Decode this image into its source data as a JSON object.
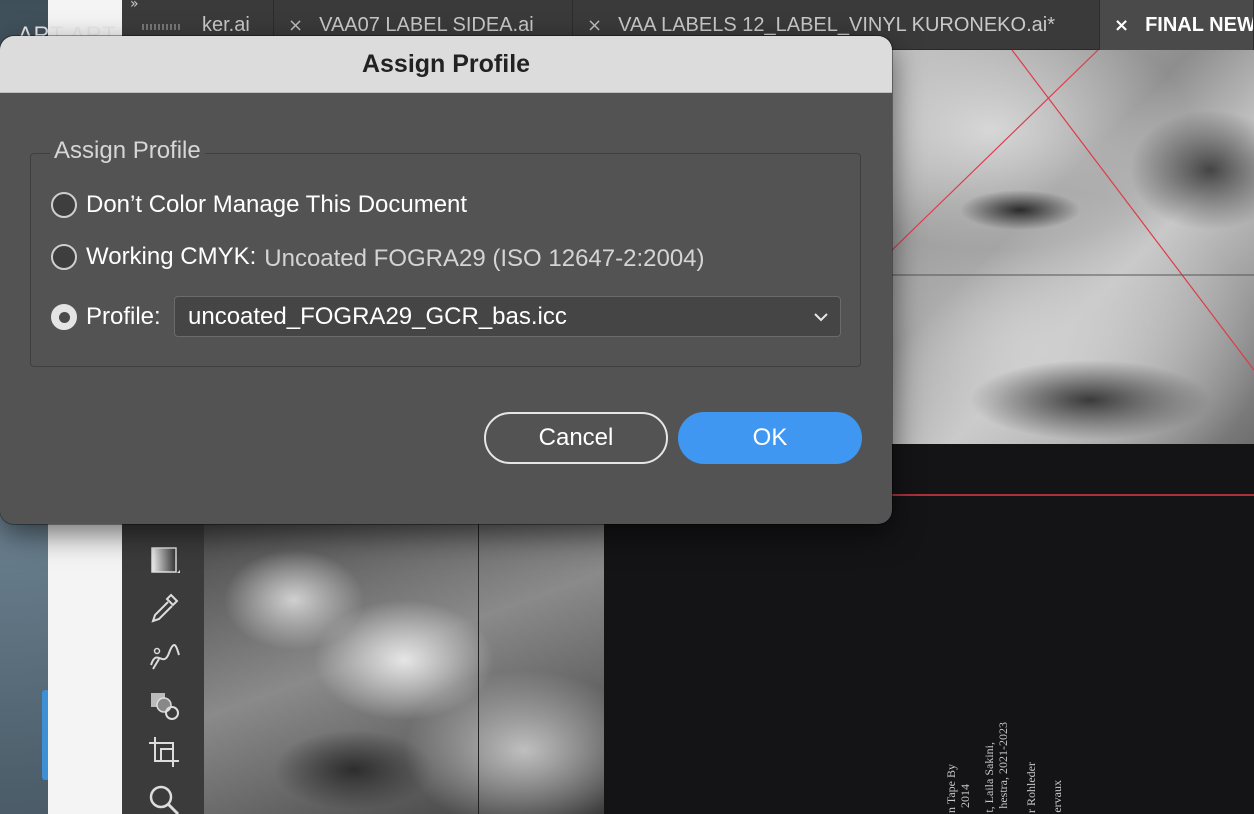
{
  "app": {
    "left_title_fragment": "ART ART"
  },
  "tabs": [
    {
      "label": "ker.ai",
      "close": "",
      "active": false
    },
    {
      "label": "VAA07 LABEL SIDEA.ai",
      "close": "×",
      "active": false
    },
    {
      "label": "VAA LABELS 12_LABEL_VINYL KURONEKO.ai*",
      "close": "×",
      "active": false
    },
    {
      "label": "FINAL NEW",
      "close": "×",
      "active": true
    }
  ],
  "toolbar": {
    "collapse_glyph": "»",
    "tools": [
      "gradient-tool-icon",
      "eyedropper-tool-icon",
      "puppet-warp-tool-icon",
      "shape-builder-tool-icon",
      "artboard-tool-icon",
      "zoom-tool-icon"
    ]
  },
  "canvas": {
    "vertical_text": [
      "n Tape By",
      "2014",
      "t, Laila Sakini,",
      "hestra, 2021-2023",
      "r Rohleder",
      "ervaux"
    ]
  },
  "dialog": {
    "title": "Assign Profile",
    "group_label": "Assign Profile",
    "options": {
      "dont_manage": {
        "label": "Don’t Color Manage This Document",
        "checked": false
      },
      "working_cmyk": {
        "label": "Working CMYK:",
        "value": "Uncoated FOGRA29 (ISO 12647-2:2004)",
        "checked": false
      },
      "profile": {
        "label": "Profile:",
        "checked": true
      }
    },
    "profile_select": {
      "selected": "uncoated_FOGRA29_GCR_bas.icc"
    },
    "buttons": {
      "cancel": "Cancel",
      "ok": "OK"
    },
    "colors": {
      "ok_button": "#3f97f2",
      "titlebar": "#dcdcdc",
      "body": "#535353"
    }
  }
}
